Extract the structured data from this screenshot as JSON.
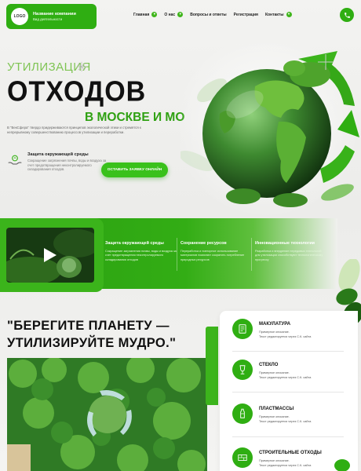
{
  "header": {
    "logo_text": "LOGO",
    "company_name": "Название компании",
    "company_activity": "Вид деятельности",
    "nav": [
      {
        "label": "Главная",
        "has_dropdown": true
      },
      {
        "label": "О нас",
        "has_dropdown": true
      },
      {
        "label": "Вопросы и ответы",
        "has_dropdown": false
      },
      {
        "label": "Регистрация",
        "has_dropdown": false
      },
      {
        "label": "Контакты",
        "has_dropdown": true
      }
    ],
    "phone_icon": "phone-icon"
  },
  "hero": {
    "subtitle": "УТИЛИЗАЦИЯ",
    "title": "ОТХОДОВ",
    "accent": "В МОСКВЕ И МО",
    "description": "В “ВекСфера” твердо придерживаются принципов экологической этики и стремятся к непрерывному совершенствованию процессов утилизации и переработки.",
    "feature_title": "Защита окружающей среды",
    "feature_text": "Сокращение загрязнения почвы, воды и воздуха за счет предотвращения неконтролируемого складирования отходов.",
    "cta_label": "ОСТАВИТЬ ЗАЯВКУ ОНЛАЙН"
  },
  "band": {
    "columns": [
      {
        "title": "Защита окружающей среды",
        "text": "Сокращение загрязнения почвы, воды и воздуха за счет предотвращения неконтролируемого складирования отходов"
      },
      {
        "title": "Сохранение ресурсов",
        "text": "Переработка и повторное использование материалов помогают сократить потребление природных ресурсов"
      },
      {
        "title": "Инновационные технологии",
        "text": "Разработка и внедрение передовых технологий для утилизации способствуют технологическому прогрессу"
      }
    ]
  },
  "quote": {
    "line1": "\"БЕРЕГИТЕ ПЛАНЕТУ —",
    "line2": "УТИЛИЗИРУЙТЕ МУДРО.\""
  },
  "services": [
    {
      "title": "МАКУЛАТУРА",
      "line1": "Примерное описание.",
      "line2": "Текст редактируется через С.К. сайта",
      "icon": "paper-icon"
    },
    {
      "title": "СТЕКЛО",
      "line1": "Примерное описание.",
      "line2": "Текст редактируется через С.К. сайта",
      "icon": "glass-icon"
    },
    {
      "title": "ПЛАСТМАССЫ",
      "line1": "Примерное описание.",
      "line2": "Текст редактируется через С.К. сайта",
      "icon": "bottle-icon"
    },
    {
      "title": "СТРОИТЕЛЬНЫЕ ОТХОДЫ",
      "line1": "Примерное описание.",
      "line2": "Текст редактируется через С.К. сайта",
      "icon": "bricks-icon"
    }
  ],
  "colors": {
    "brand_green": "#2fae12",
    "accent_green": "#39c11b",
    "light_green_text": "#7fc454"
  }
}
